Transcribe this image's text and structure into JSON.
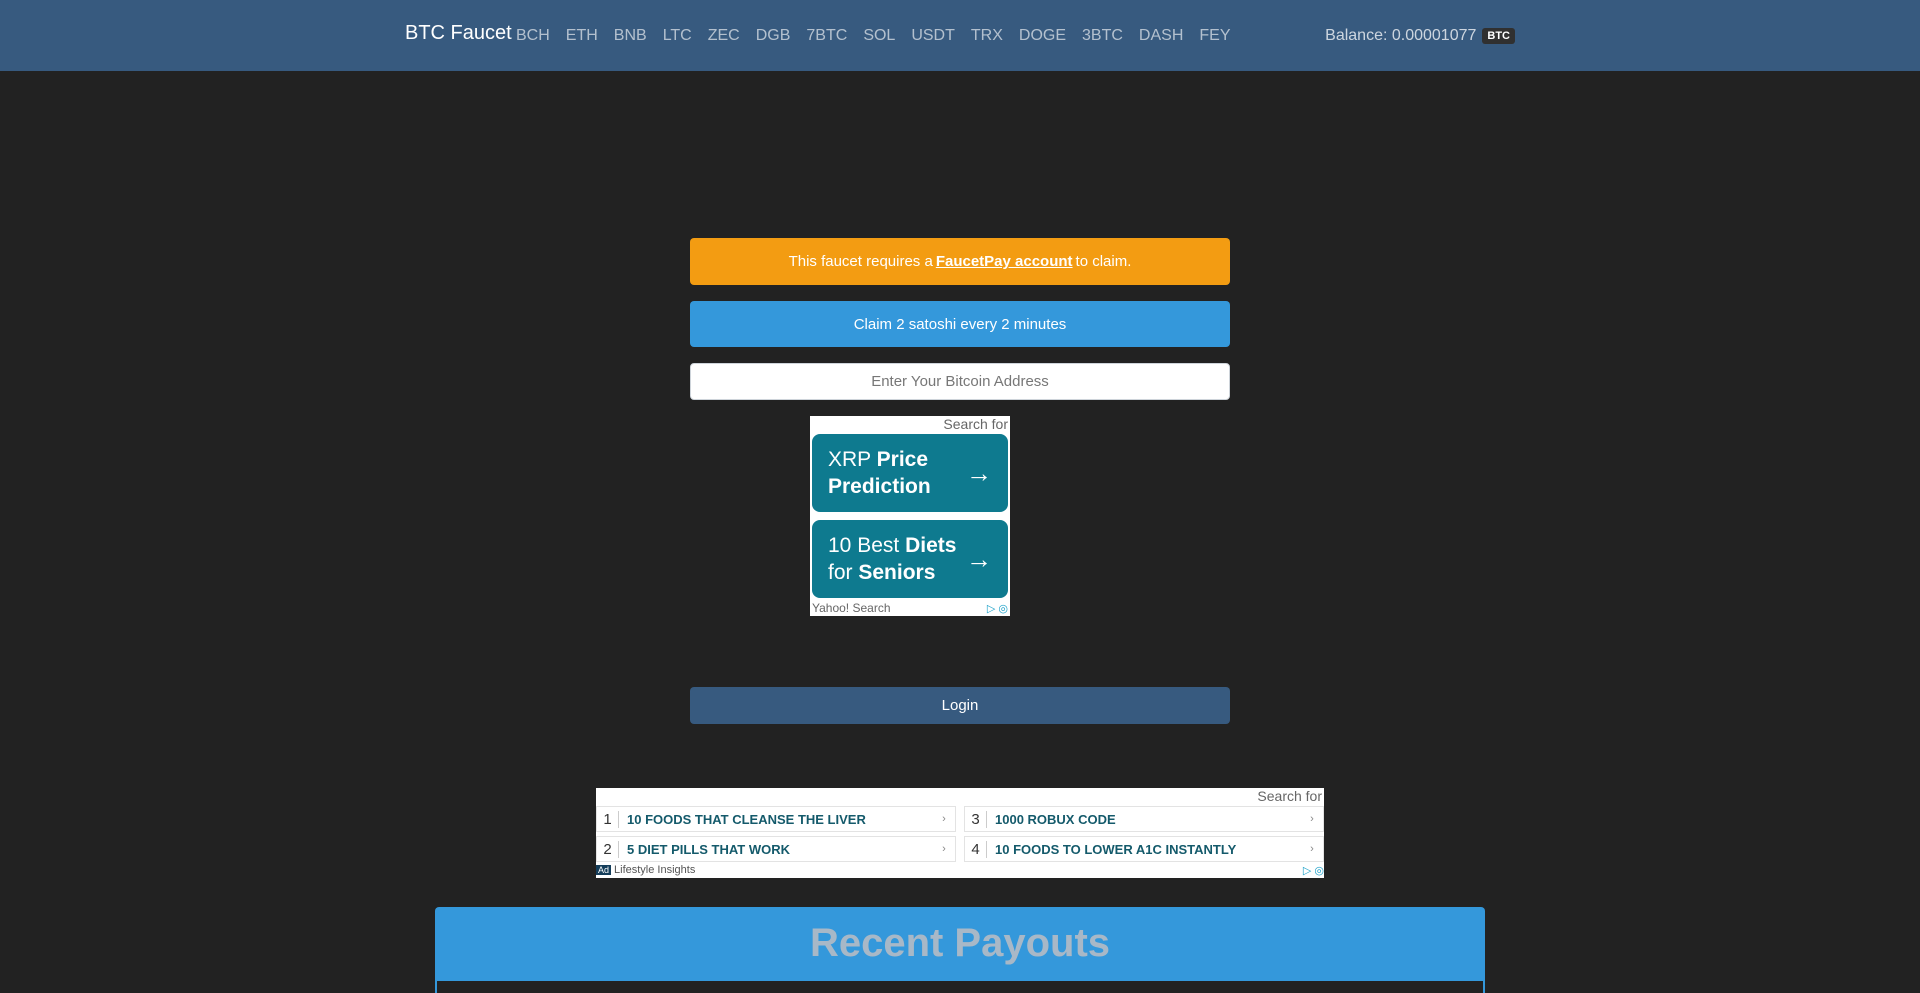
{
  "navbar": {
    "brand": "BTC Faucet",
    "links": [
      "BCH",
      "ETH",
      "BNB",
      "LTC",
      "ZEC",
      "DGB",
      "7BTC",
      "SOL",
      "USDT",
      "TRX",
      "DOGE",
      "3BTC",
      "DASH",
      "FEY"
    ],
    "balance_label": "Balance: 0.00001077",
    "balance_currency": "BTC"
  },
  "alerts": {
    "requirement_prefix": "This faucet requires a",
    "requirement_link": "FaucetPay account",
    "requirement_suffix": "to claim.",
    "claim_info": "Claim 2 satoshi every 2 minutes"
  },
  "address_input": {
    "placeholder": "Enter Your Bitcoin Address",
    "value": ""
  },
  "ad_small": {
    "search_label": "Search for",
    "tile1_plain": "XRP ",
    "tile1_bold": "Price Prediction",
    "tile2_plain1": "10 Best ",
    "tile2_bold1": "Diets",
    "tile2_plain2": "for ",
    "tile2_bold2": "Seniors",
    "arrow": "→",
    "footer": "Yahoo! Search"
  },
  "login_button": "Login",
  "ad_wide": {
    "search_label": "Search for",
    "items": [
      {
        "num": "1",
        "text": "10 FOODS THAT CLEANSE THE LIVER"
      },
      {
        "num": "2",
        "text": "5 DIET PILLS THAT WORK"
      },
      {
        "num": "3",
        "text": "1000 ROBUX CODE"
      },
      {
        "num": "4",
        "text": "10 FOODS TO LOWER A1C INSTANTLY"
      }
    ],
    "ad_tag": "Ad",
    "footer": "Lifestyle Insights"
  },
  "payouts": {
    "title": "Recent Payouts"
  },
  "colors": {
    "navbar": "#375a7f",
    "background": "#222222",
    "warning": "#f39c12",
    "info": "#3498db",
    "ad_tile": "#0e7a8f"
  }
}
